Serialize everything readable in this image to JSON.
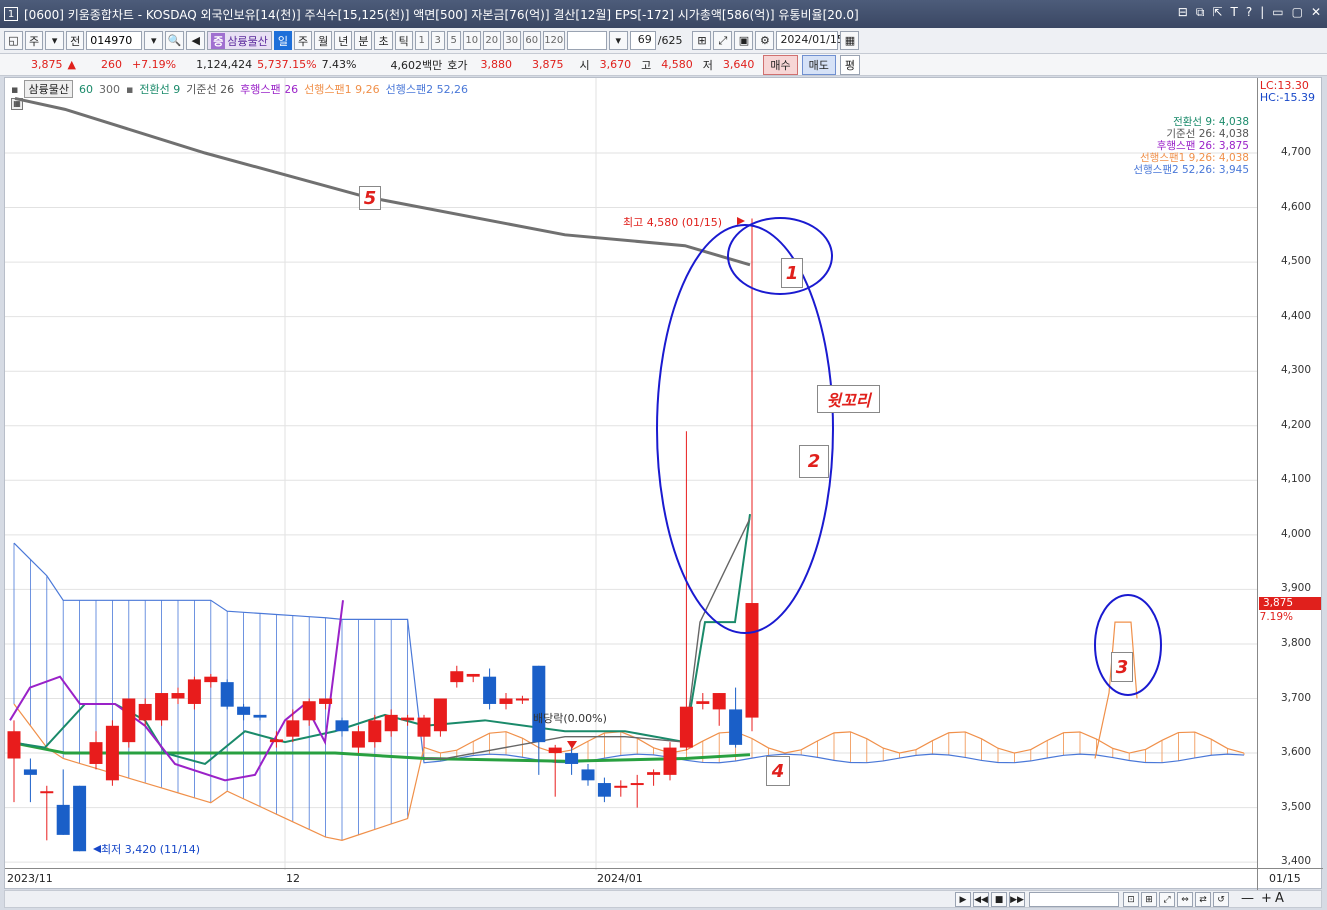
{
  "window": {
    "number": "1",
    "title": "[0600] 키움종합차트 - KOSDAQ 외국인보유[14(천)] 주식수[15,125(천)] 액면[500] 자본금[76(억)] 결산[12월] EPS[-172] 시가총액[586(억)] 유통비율[20.0]",
    "controls": [
      "⊟",
      "⧉",
      "⇱",
      "T",
      "?",
      "|",
      "▭",
      "▢",
      "✕"
    ]
  },
  "toolbar": {
    "ju": "주",
    "jeon": "전",
    "code": "014970",
    "stock_name": "삼륭물산",
    "periods": [
      "일",
      "주",
      "월",
      "년",
      "분",
      "초",
      "틱"
    ],
    "active_period": "일",
    "nums": [
      "1",
      "3",
      "5",
      "10",
      "20",
      "30",
      "60",
      "120"
    ],
    "count": "69",
    "total": "/625",
    "date": "2024/01/15"
  },
  "quote": {
    "price": "3,875",
    "arrow": "▲",
    "change": "260",
    "change_pct": "+7.19%",
    "volume": "1,124,424",
    "vol_pct": "5,737.15%",
    "turnover": "7.43%",
    "amount": "4,602백만",
    "hoga_label": "호가",
    "ask": "3,880",
    "bid": "3,875",
    "open_label": "시",
    "open": "3,670",
    "high_label": "고",
    "high": "4,580",
    "low_label": "저",
    "low": "3,640",
    "buy": "매수",
    "sell": "매도",
    "eval": "평"
  },
  "legend": {
    "stock": "삼륭물산",
    "ma60": "60",
    "ma300": "300",
    "tenkan": "전환선 9",
    "kijun": "기준선 26",
    "chikou": "후행스팬 26",
    "senkou1": "선행스팬1 9,26",
    "senkou2": "선행스팬2 52,26"
  },
  "indicator_values": [
    {
      "text": "전환선 9: 4,038",
      "color": "#1a8a6a"
    },
    {
      "text": "기준선 26: 4,038",
      "color": "#555555"
    },
    {
      "text": "후행스팬 26: 3,875",
      "color": "#9a22c8"
    },
    {
      "text": "선행스팬1 9,26: 4,038",
      "color": "#f0904a"
    },
    {
      "text": "선행스팬2 52,26: 3,945",
      "color": "#4a78d8"
    }
  ],
  "lc": "LC:13.30",
  "hc": "HC:-15.39",
  "price_tag": "3,875",
  "price_pct": "7.19%",
  "x_labels": [
    "2023/11",
    "12",
    "2024/01",
    "01/15"
  ],
  "annotations": {
    "n1": "1",
    "n2": "2",
    "n3": "3",
    "n4": "4",
    "n5": "5",
    "tail": "윗꼬리",
    "high_note": "최고 4,580 (01/15)",
    "low_note": "최저 3,420 (11/14)",
    "dividend": "배당락(0.00%)"
  },
  "chart_data": {
    "type": "candlestick",
    "y_ticks": [
      4700,
      4600,
      4500,
      4400,
      4300,
      4200,
      4100,
      4000,
      3900,
      3800,
      3700,
      3600,
      3500,
      3400
    ],
    "ylim": [
      3380,
      4780
    ],
    "candles": [
      {
        "o": 3590,
        "c": 3640,
        "h": 3660,
        "l": 3510
      },
      {
        "o": 3570,
        "c": 3560,
        "h": 3590,
        "l": 3510
      },
      {
        "o": 3530,
        "c": 3530,
        "h": 3540,
        "l": 3440
      },
      {
        "o": 3505,
        "c": 3450,
        "h": 3570,
        "l": 3450
      },
      {
        "o": 3540,
        "c": 3420,
        "h": 3540,
        "l": 3420
      },
      {
        "o": 3580,
        "c": 3620,
        "h": 3640,
        "l": 3570
      },
      {
        "o": 3550,
        "c": 3650,
        "h": 3660,
        "l": 3540
      },
      {
        "o": 3620,
        "c": 3700,
        "h": 3700,
        "l": 3610
      },
      {
        "o": 3660,
        "c": 3690,
        "h": 3700,
        "l": 3650
      },
      {
        "o": 3660,
        "c": 3710,
        "h": 3710,
        "l": 3650
      },
      {
        "o": 3700,
        "c": 3710,
        "h": 3720,
        "l": 3690
      },
      {
        "o": 3690,
        "c": 3735,
        "h": 3740,
        "l": 3680
      },
      {
        "o": 3730,
        "c": 3740,
        "h": 3745,
        "l": 3720
      },
      {
        "o": 3730,
        "c": 3685,
        "h": 3735,
        "l": 3680
      },
      {
        "o": 3685,
        "c": 3670,
        "h": 3690,
        "l": 3660
      },
      {
        "o": 3670,
        "c": 3665,
        "h": 3670,
        "l": 3660
      },
      {
        "o": 3620,
        "c": 3625,
        "h": 3640,
        "l": 3610
      },
      {
        "o": 3630,
        "c": 3660,
        "h": 3680,
        "l": 3620
      },
      {
        "o": 3660,
        "c": 3695,
        "h": 3700,
        "l": 3650
      },
      {
        "o": 3690,
        "c": 3700,
        "h": 3700,
        "l": 3680
      },
      {
        "o": 3660,
        "c": 3640,
        "h": 3665,
        "l": 3630
      },
      {
        "o": 3610,
        "c": 3640,
        "h": 3650,
        "l": 3600
      },
      {
        "o": 3620,
        "c": 3660,
        "h": 3670,
        "l": 3610
      },
      {
        "o": 3640,
        "c": 3670,
        "h": 3680,
        "l": 3630
      },
      {
        "o": 3660,
        "c": 3665,
        "h": 3670,
        "l": 3650
      },
      {
        "o": 3630,
        "c": 3665,
        "h": 3670,
        "l": 3610
      },
      {
        "o": 3640,
        "c": 3700,
        "h": 3700,
        "l": 3630
      },
      {
        "o": 3730,
        "c": 3750,
        "h": 3760,
        "l": 3720
      },
      {
        "o": 3740,
        "c": 3745,
        "h": 3745,
        "l": 3730
      },
      {
        "o": 3740,
        "c": 3690,
        "h": 3755,
        "l": 3680
      },
      {
        "o": 3690,
        "c": 3700,
        "h": 3710,
        "l": 3680
      },
      {
        "o": 3700,
        "c": 3700,
        "h": 3705,
        "l": 3690
      },
      {
        "o": 3760,
        "c": 3620,
        "h": 3760,
        "l": 3560
      },
      {
        "o": 3600,
        "c": 3610,
        "h": 3615,
        "l": 3520
      },
      {
        "o": 3600,
        "c": 3580,
        "h": 3610,
        "l": 3560
      },
      {
        "o": 3570,
        "c": 3550,
        "h": 3580,
        "l": 3540
      },
      {
        "o": 3545,
        "c": 3520,
        "h": 3555,
        "l": 3510
      },
      {
        "o": 3540,
        "c": 3540,
        "h": 3550,
        "l": 3520
      },
      {
        "o": 3545,
        "c": 3545,
        "h": 3560,
        "l": 3500
      },
      {
        "o": 3560,
        "c": 3565,
        "h": 3570,
        "l": 3540
      },
      {
        "o": 3560,
        "c": 3610,
        "h": 3620,
        "l": 3550
      },
      {
        "o": 3610,
        "c": 3685,
        "h": 4190,
        "l": 3605
      },
      {
        "o": 3690,
        "c": 3695,
        "h": 3710,
        "l": 3680
      },
      {
        "o": 3680,
        "c": 3710,
        "h": 3710,
        "l": 3650
      },
      {
        "o": 3680,
        "c": 3615,
        "h": 3720,
        "l": 3610
      },
      {
        "o": 3665,
        "c": 3875,
        "h": 4580,
        "l": 3640
      }
    ],
    "bull_color": "#e81c1c",
    "bear_color": "#1a5fc8"
  }
}
